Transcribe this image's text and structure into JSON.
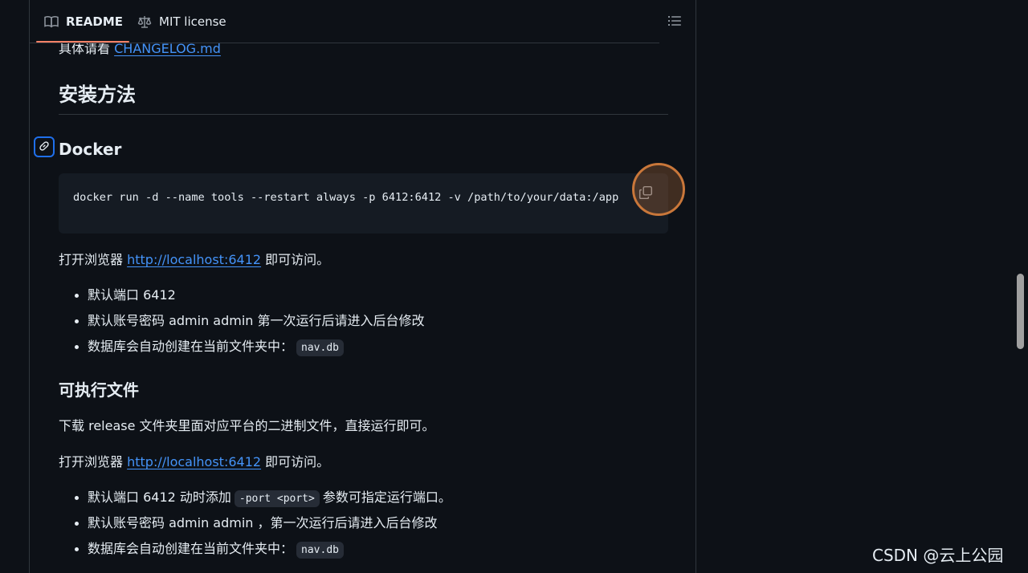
{
  "tabs": {
    "readme_label": "README",
    "license_label": "MIT license"
  },
  "content": {
    "changelog_prefix": "具体请看",
    "changelog_link": "CHANGELOG.md",
    "install_heading": "安装方法",
    "docker": {
      "heading": "Docker",
      "command": "docker run -d --name tools --restart always -p 6412:6412 -v /path/to/your/data:/app",
      "open_prefix": "打开浏览器",
      "open_link": "http://localhost:6412",
      "open_suffix": "即可访问。",
      "bullets": {
        "port": "默认端口 6412",
        "account": "默认账号密码 admin admin 第一次运行后请进入后台修改",
        "db_prefix": "数据库会自动创建在当前文件夹中：",
        "db_code": "nav.db"
      }
    },
    "binary": {
      "heading": "可执行文件",
      "download_text": "下载 release 文件夹里面对应平台的二进制文件，直接运行即可。",
      "open_prefix": "打开浏览器",
      "open_link": "http://localhost:6412",
      "open_suffix": "即可访问。",
      "bullets": {
        "port_prefix": "默认端口 6412 动时添加",
        "port_code": "-port <port>",
        "port_suffix": "参数可指定运行端口。",
        "account": "默认账号密码 admin admin ，第一次运行后请进入后台修改",
        "db_prefix": "数据库会自动创建在当前文件夹中：",
        "db_code": "nav.db"
      }
    }
  },
  "watermark": "CSDN @云上公园",
  "icons": {
    "readme": "book-icon",
    "license": "scale-icon",
    "outline": "list-icon",
    "anchor": "link-icon",
    "copy": "copy-icon"
  },
  "colors": {
    "background": "#0d1117",
    "link": "#4493f8",
    "tab_underline": "#f78166",
    "focus_ring": "#1f6feb",
    "click_indicator": "#c9773a"
  }
}
